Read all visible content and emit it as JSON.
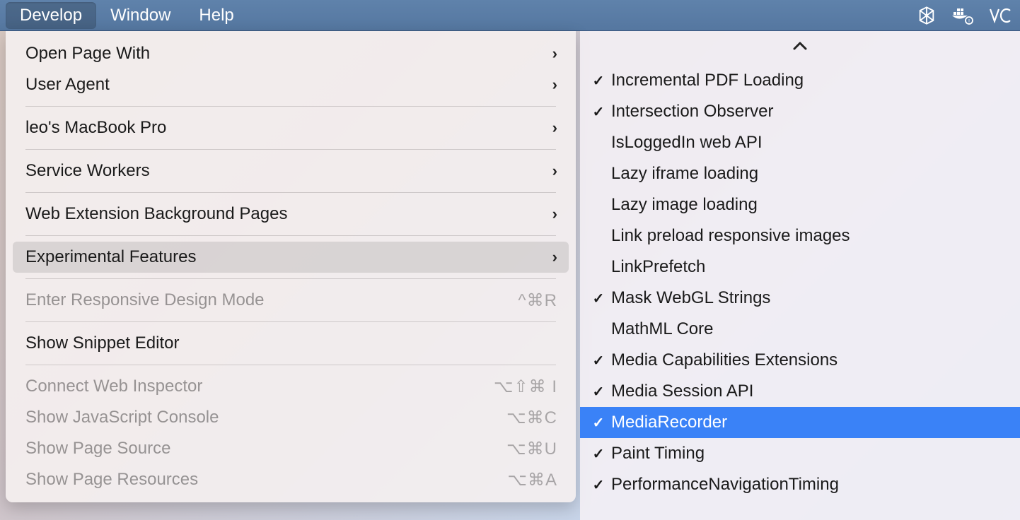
{
  "menubar": {
    "develop": "Develop",
    "window": "Window",
    "help": "Help"
  },
  "dropdown": {
    "open_page_with": "Open Page With",
    "user_agent": "User Agent",
    "device": "leo's MacBook Pro",
    "service_workers": "Service Workers",
    "web_ext_bg": "Web Extension Background Pages",
    "experimental": "Experimental Features",
    "responsive": "Enter Responsive Design Mode",
    "responsive_sc": "^⌘R",
    "snippet": "Show Snippet Editor",
    "connect_inspector": "Connect Web Inspector",
    "connect_inspector_sc": "⌥⇧⌘ I",
    "js_console": "Show JavaScript Console",
    "js_console_sc": "⌥⌘C",
    "page_source": "Show Page Source",
    "page_source_sc": "⌥⌘U",
    "page_resources": "Show Page Resources",
    "page_resources_sc": "⌥⌘A"
  },
  "submenu": {
    "items": [
      {
        "label": "Incremental PDF Loading",
        "checked": true,
        "hl": false
      },
      {
        "label": "Intersection Observer",
        "checked": true,
        "hl": false
      },
      {
        "label": "IsLoggedIn web API",
        "checked": false,
        "hl": false
      },
      {
        "label": "Lazy iframe loading",
        "checked": false,
        "hl": false
      },
      {
        "label": "Lazy image loading",
        "checked": false,
        "hl": false
      },
      {
        "label": "Link preload responsive images",
        "checked": false,
        "hl": false
      },
      {
        "label": "LinkPrefetch",
        "checked": false,
        "hl": false
      },
      {
        "label": "Mask WebGL Strings",
        "checked": true,
        "hl": false
      },
      {
        "label": "MathML Core",
        "checked": false,
        "hl": false
      },
      {
        "label": "Media Capabilities Extensions",
        "checked": true,
        "hl": false
      },
      {
        "label": "Media Session API",
        "checked": true,
        "hl": false
      },
      {
        "label": "MediaRecorder",
        "checked": true,
        "hl": true
      },
      {
        "label": "Paint Timing",
        "checked": true,
        "hl": false
      },
      {
        "label": "PerformanceNavigationTiming",
        "checked": true,
        "hl": false
      }
    ]
  }
}
